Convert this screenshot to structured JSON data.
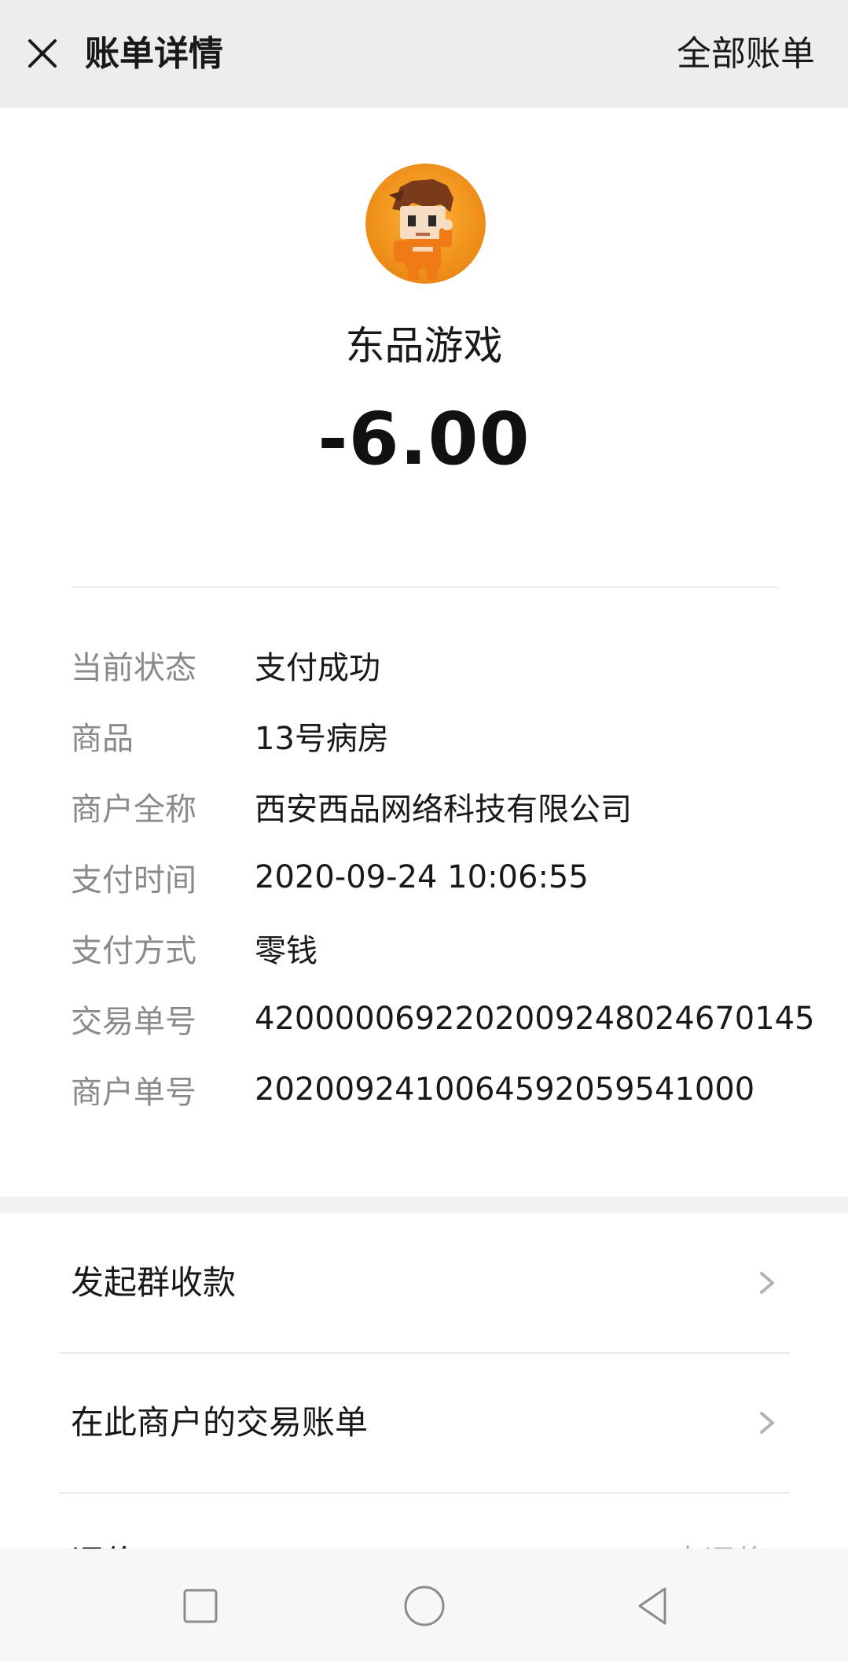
{
  "header": {
    "title": "账单详情",
    "right_link": "全部账单"
  },
  "merchant": {
    "name": "东品游戏",
    "amount": "-6.00",
    "avatar_icon": "game-character-avatar"
  },
  "details": [
    {
      "label": "当前状态",
      "value": "支付成功"
    },
    {
      "label": "商品",
      "value": "13号病房"
    },
    {
      "label": "商户全称",
      "value": "西安西品网络科技有限公司"
    },
    {
      "label": "支付时间",
      "value": "2020-09-24 10:06:55"
    },
    {
      "label": "支付方式",
      "value": "零钱"
    },
    {
      "label": "交易单号",
      "value": "4200000692202009248024670145"
    },
    {
      "label": "商户单号",
      "value": "2020092410064592059541000"
    }
  ],
  "actions": [
    {
      "label": "发起群收款"
    },
    {
      "label": "在此商户的交易账单"
    }
  ],
  "partial_item": {
    "left": "评价",
    "right": "去评价"
  },
  "colors": {
    "header_bg": "#ededed",
    "label_gray": "#8a8a8a",
    "avatar_orange": "#f39a1e"
  },
  "navbar": {
    "icons": [
      "square-recent-apps-icon",
      "circle-home-icon",
      "triangle-back-icon"
    ]
  }
}
